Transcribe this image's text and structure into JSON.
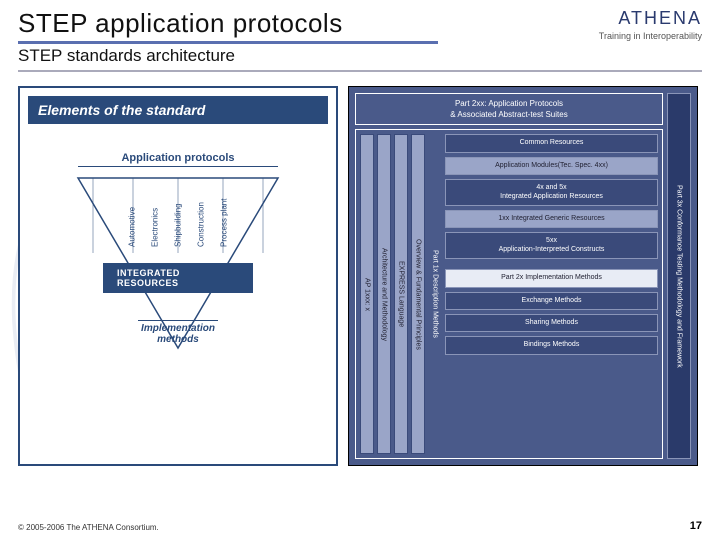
{
  "header": {
    "title": "STEP application protocols",
    "subtitle": "STEP standards architecture",
    "logo": "ATHENA",
    "logo_sub": "Training in Interoperability"
  },
  "left": {
    "title": "Elements of the standard",
    "app_protocols": "Application protocols",
    "verticals": [
      "Automotive",
      "Electronics",
      "Shipbuilding",
      "Construction",
      "Process plant"
    ],
    "integrated": "INTEGRATED RESOURCES",
    "impl": "Implementation\nmethods"
  },
  "right": {
    "top": "Part 2xx: Application Protocols\n& Associated Abstract-test Suites",
    "vstrips": [
      "AP 1xxx: x",
      "Architecture and Methodology",
      "EXPRESS Language",
      "Overview & Fundamental Principles"
    ],
    "left_label": "Part 1x Description Methods",
    "stack_top": [
      "Common Resources",
      "Application Modules(Tec. Spec. 4xx)",
      "4x and 5x\nIntegrated Application Resources",
      "1xx Integrated Generic Resources",
      "5xx\nApplication-Interpreted Constructs"
    ],
    "impl_label": "Part 2x Implementation Methods",
    "stack_bot": [
      "Exchange Methods",
      "Sharing Methods",
      "Bindings Methods"
    ],
    "side": "Part 3x Conformance Testing Methodology and Framework"
  },
  "footer": {
    "copyright": "© 2005-2006 The ATHENA Consortium.",
    "page": "17"
  }
}
